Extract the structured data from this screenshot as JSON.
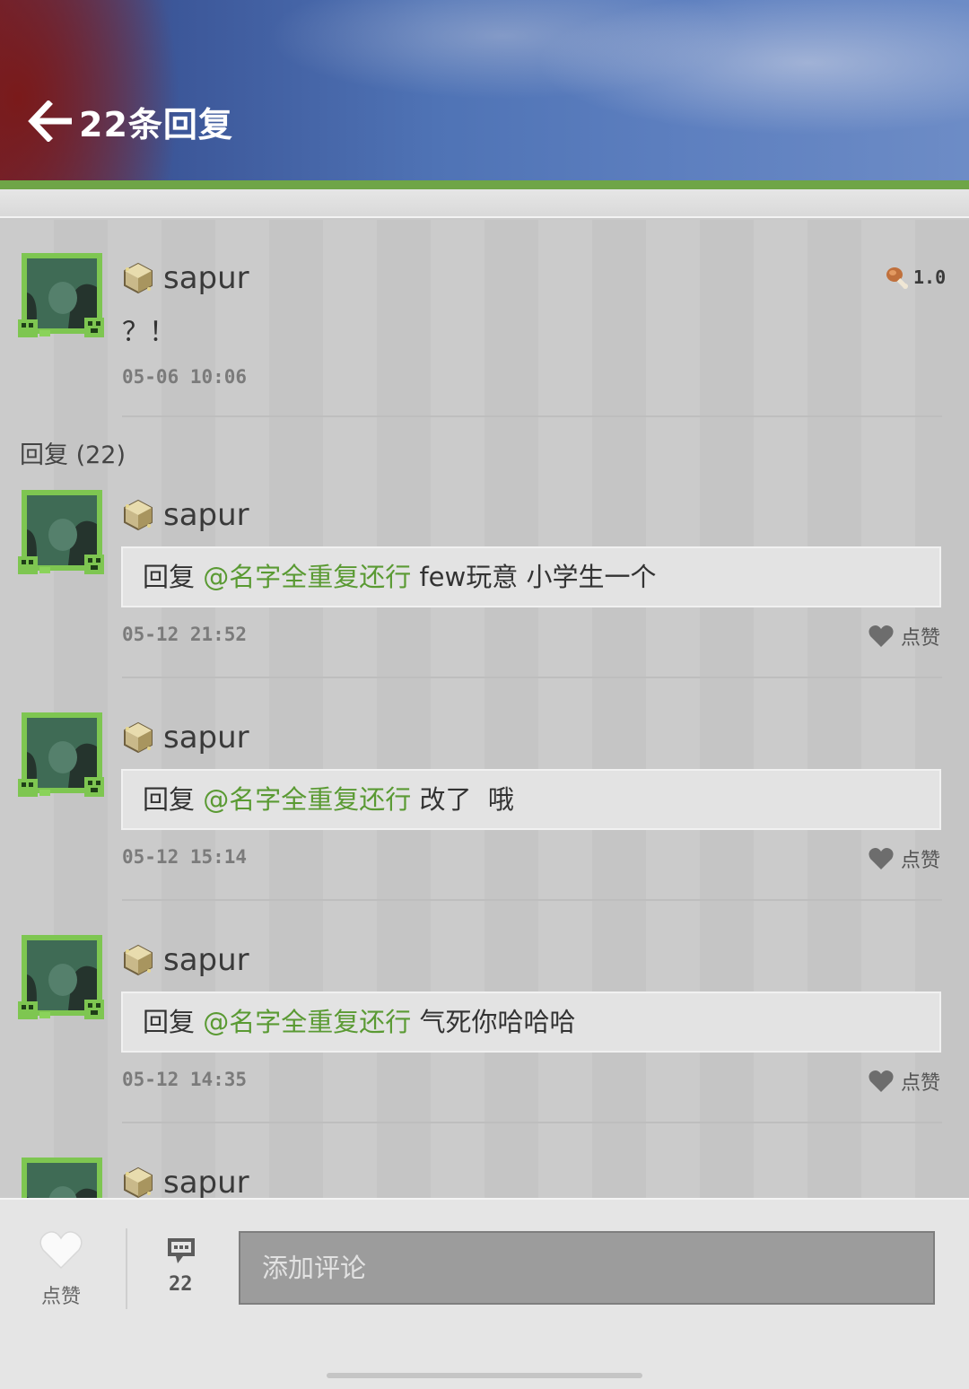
{
  "header": {
    "title": "22条回复",
    "back_icon": "arrow-left-icon"
  },
  "post": {
    "username": "sapur",
    "badge_icon": "cube-gem-icon",
    "text": "？！",
    "time": "05-06 10:06",
    "version_icon": "drumstick-icon",
    "version": "1.0"
  },
  "replies_label": "回复 (22)",
  "replies": [
    {
      "username": "sapur",
      "prefix": "回复",
      "mention": "@名字全重复还行",
      "text": "few玩意 小学生一个",
      "time": "05-12 21:52",
      "like_label": "点赞"
    },
    {
      "username": "sapur",
      "prefix": "回复",
      "mention": "@名字全重复还行",
      "text": "改了  哦",
      "time": "05-12 15:14",
      "like_label": "点赞"
    },
    {
      "username": "sapur",
      "prefix": "回复",
      "mention": "@名字全重复还行",
      "text": "气死你哈哈哈",
      "time": "05-12 14:35",
      "like_label": "点赞"
    },
    {
      "username": "sapur"
    }
  ],
  "bottom_bar": {
    "like_label": "点赞",
    "like_icon": "heart-icon",
    "comment_icon": "chat-bubble-icon",
    "comment_count": "22",
    "input_placeholder": "添加评论"
  },
  "colors": {
    "accent_green": "#6fa547",
    "mention_green": "#5a9a33"
  }
}
